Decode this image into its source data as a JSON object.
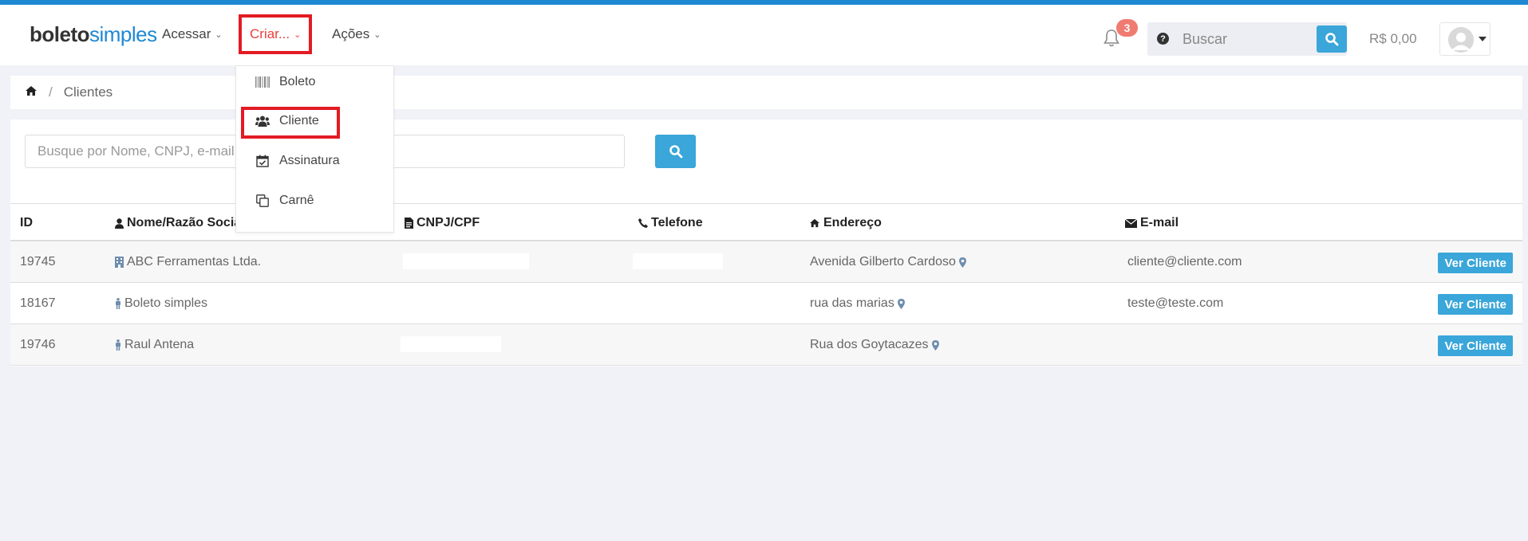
{
  "app": {
    "logo_part1": "boleto",
    "logo_part2": "simples"
  },
  "nav": {
    "acessar": "Acessar",
    "criar": "Criar...",
    "acoes": "Ações"
  },
  "dropdown": {
    "items": [
      {
        "label": "Boleto",
        "icon": "barcode-icon"
      },
      {
        "label": "Cliente",
        "icon": "users-icon"
      },
      {
        "label": "Assinatura",
        "icon": "calendar-check-icon"
      },
      {
        "label": "Carnê",
        "icon": "copy-icon"
      }
    ]
  },
  "header": {
    "notification_count": "3",
    "search_placeholder": "Buscar",
    "balance": "R$ 0,00"
  },
  "breadcrumb": {
    "current": "Clientes",
    "separator": "/"
  },
  "filter": {
    "placeholder": "Busque por Nome, CNPJ, e-mail..."
  },
  "table": {
    "headers": {
      "id": "ID",
      "name": "Nome/Razão Social",
      "cnpj": "CNPJ/CPF",
      "phone": "Telefone",
      "address": "Endereço",
      "email": "E-mail"
    },
    "rows": [
      {
        "id": "19745",
        "name": "ABC Ferramentas Ltda.",
        "type_icon": "building-icon",
        "address": "Avenida Gilberto Cardoso",
        "email": "cliente@cliente.com",
        "action": "Ver Cliente"
      },
      {
        "id": "18167",
        "name": "Boleto simples",
        "type_icon": "person-icon",
        "address": "rua das marias",
        "email": "teste@teste.com",
        "action": "Ver Cliente"
      },
      {
        "id": "19746",
        "name": "Raul Antena",
        "type_icon": "person-icon",
        "address": "Rua dos Goytacazes",
        "email": "",
        "action": "Ver Cliente"
      }
    ]
  },
  "colors": {
    "accent": "#3aa6d9",
    "highlight": "#e31b23",
    "top_stripe": "#1e88d3"
  }
}
